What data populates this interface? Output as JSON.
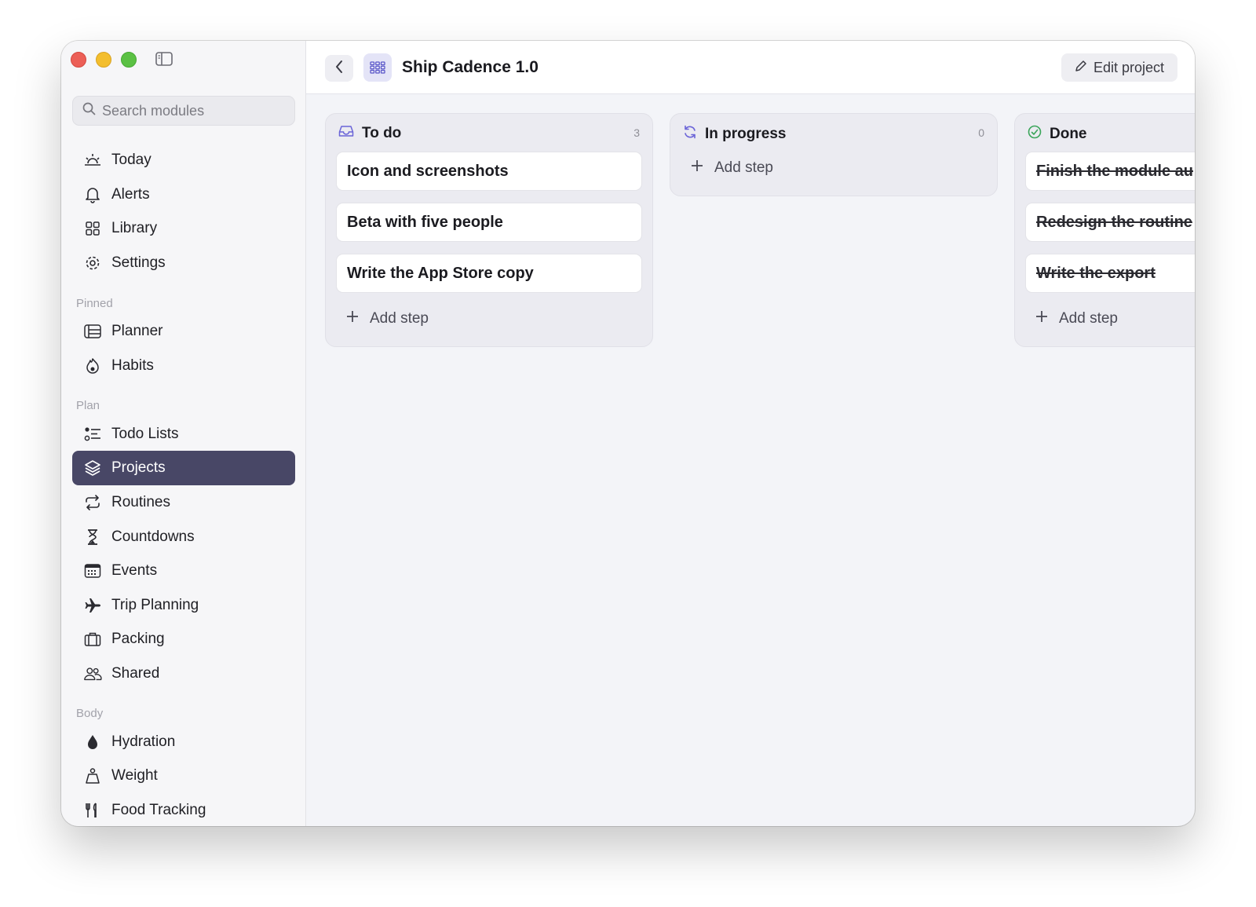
{
  "sidebar": {
    "search_placeholder": "Search modules",
    "items_top": [
      "Today",
      "Alerts",
      "Library",
      "Settings"
    ],
    "section_pinned": "Pinned",
    "items_pinned": [
      "Planner",
      "Habits"
    ],
    "section_plan": "Plan",
    "items_plan": [
      "Todo Lists",
      "Projects",
      "Routines",
      "Countdowns",
      "Events",
      "Trip Planning",
      "Packing",
      "Shared"
    ],
    "section_body": "Body",
    "items_body": [
      "Hydration",
      "Weight",
      "Food Tracking"
    ],
    "active_item": "Projects"
  },
  "header": {
    "title": "Ship Cadence 1.0",
    "edit_label": "Edit project"
  },
  "board": {
    "columns": [
      {
        "title": "To do",
        "count": "3",
        "cards": [
          "Icon and screenshots",
          "Beta with five people",
          "Write the App Store copy"
        ],
        "add_label": "Add step"
      },
      {
        "title": "In progress",
        "count": "0",
        "cards": [],
        "add_label": "Add step"
      },
      {
        "title": "Done",
        "count": "",
        "cards": [
          "Finish the module au",
          "Redesign the routine",
          "Write the export"
        ],
        "add_label": "Add step"
      }
    ]
  },
  "colors": {
    "active_nav": "#484766",
    "accent": "#6b64d8",
    "done_green": "#3aa55a"
  }
}
